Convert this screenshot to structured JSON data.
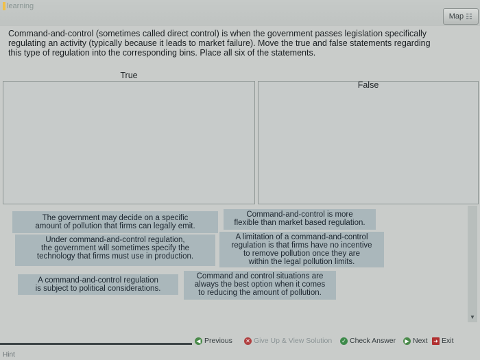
{
  "header": {
    "brand": "learning",
    "map_label": "Map",
    "map_icon": "map-icon"
  },
  "instructions": {
    "line1": "Command-and-control (sometimes called direct control) is when the government passes legislation specifically",
    "line2": "regulating an activity (typically because it leads to market failure). Move the true and false statements regarding",
    "line3": "this type of regulation into the corresponding bins. Place all six of the statements."
  },
  "bins": {
    "true_label": "True",
    "false_label": "False"
  },
  "statements": [
    {
      "lines": [
        "The government may decide on a specific",
        "amount of pollution that firms can legally emit."
      ]
    },
    {
      "lines": [
        "Command-and-control is more",
        "flexible than market based regulation."
      ]
    },
    {
      "lines": [
        "Under command-and-control regulation,",
        "the government will sometimes specify the",
        "technology that firms must use in production."
      ]
    },
    {
      "lines": [
        "A limitation of a command-and-control",
        "regulation is that firms have no incentive",
        "to remove pollution once they are",
        "within the legal pollution limits."
      ]
    },
    {
      "lines": [
        "A command-and-control regulation",
        "is subject to political considerations."
      ]
    },
    {
      "lines": [
        "Command and control situations are",
        "always the best option when it comes",
        "to reducing the amount of pollution."
      ]
    }
  ],
  "footer": {
    "previous": "Previous",
    "give_up": "Give Up & View Solution",
    "check_answer": "Check Answer",
    "next": "Next",
    "exit": "Exit",
    "hint": "Hint"
  },
  "colors": {
    "card": "#aab7bb",
    "bin_border": "#8f9795",
    "background": "#c9ccca"
  }
}
